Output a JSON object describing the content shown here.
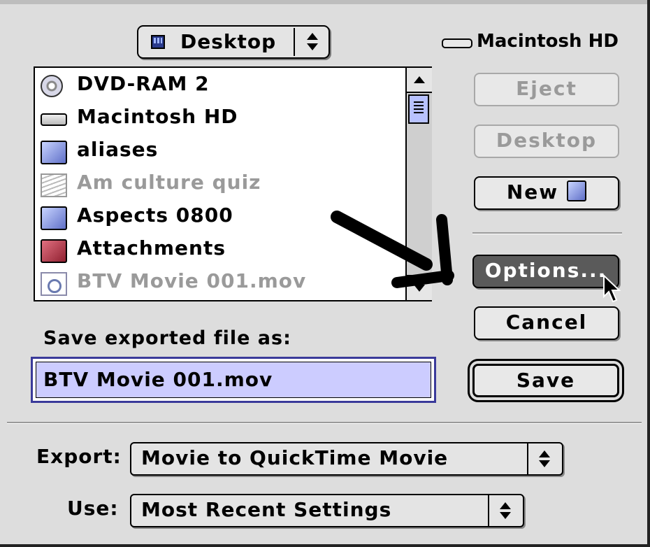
{
  "location": {
    "label": "Desktop"
  },
  "disk": {
    "name": "Macintosh HD"
  },
  "files": [
    {
      "name": "DVD-RAM 2",
      "icon": "cd-icon",
      "dimmed": false
    },
    {
      "name": "Macintosh HD",
      "icon": "hard-disk-icon",
      "dimmed": false
    },
    {
      "name": "aliases",
      "icon": "folder-icon",
      "dimmed": false
    },
    {
      "name": "Am culture quiz",
      "icon": "document-stack-icon",
      "dimmed": true
    },
    {
      "name": "Aspects 0800",
      "icon": "folder-icon",
      "dimmed": false
    },
    {
      "name": "Attachments",
      "icon": "red-folder-icon",
      "dimmed": false
    },
    {
      "name": "BTV Movie 001.mov",
      "icon": "movie-file-icon",
      "dimmed": true
    }
  ],
  "buttons": {
    "eject": "Eject",
    "desktop": "Desktop",
    "new": "New",
    "options": "Options...",
    "cancel": "Cancel",
    "save": "Save"
  },
  "save_as": {
    "label": "Save exported file as:",
    "value": "BTV Movie 001.mov"
  },
  "export": {
    "label": "Export:",
    "value": "Movie to QuickTime Movie"
  },
  "use": {
    "label": "Use:",
    "value": "Most Recent Settings"
  },
  "colors": {
    "dialog_bg": "#dddddd",
    "selection": "#ccccff",
    "scroll_thumb": "#b8c2ff",
    "options_active": "#5a5a5a"
  }
}
